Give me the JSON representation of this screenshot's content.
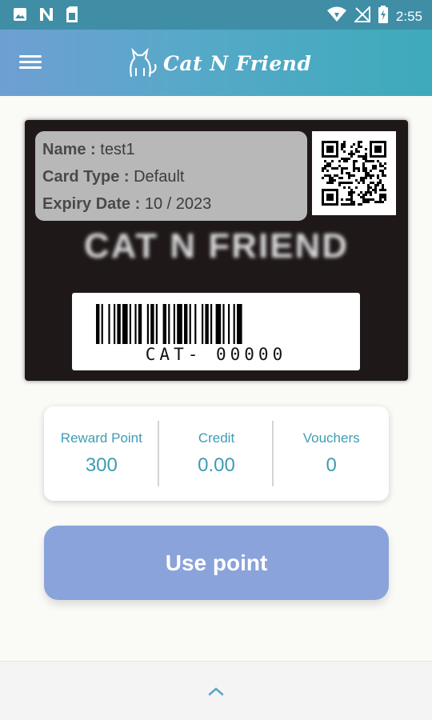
{
  "status_bar": {
    "time": "2:55",
    "left_icons": [
      "image-icon",
      "n-app-icon",
      "sim-card-icon"
    ],
    "right_icons": [
      "wifi-icon",
      "no-signal-icon",
      "battery-charging-icon"
    ]
  },
  "app_bar": {
    "logo_text": "Cat N Friend",
    "menu_icon": "hamburger-menu-icon"
  },
  "member_card": {
    "name_label": "Name :",
    "name_value": "test1",
    "card_type_label": "Card Type :",
    "card_type_value": "Default",
    "expiry_label": "Expiry Date :",
    "expiry_value": "10 / 2023",
    "brand": "CAT N FRIEND",
    "barcode_number": "CAT- 00000"
  },
  "stats": [
    {
      "label": "Reward Point",
      "value": "300"
    },
    {
      "label": "Credit",
      "value": "0.00"
    },
    {
      "label": "Vouchers",
      "value": "0"
    }
  ],
  "use_point_label": "Use point",
  "colors": {
    "accent": "#3d9cb4",
    "button": "#8aa3da",
    "card_bg": "#1f1819"
  }
}
